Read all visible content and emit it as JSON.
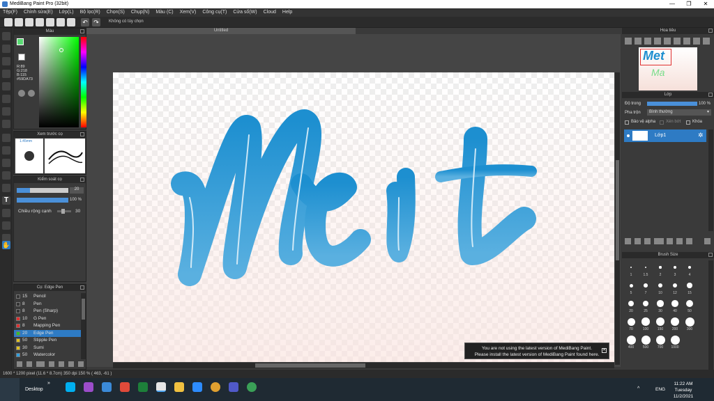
{
  "window": {
    "title": "MediBang Paint Pro (32bit)"
  },
  "menu": [
    "Tệp(F)",
    "Chỉnh sửa(E)",
    "Lớp(L)",
    "Bộ lọc(R)",
    "Chọn(S)",
    "Chụp(N)",
    "Màu (C)",
    "Xem(V)",
    "Công cụ(T)",
    "Cửa sổ(W)",
    "Cloud",
    "Help"
  ],
  "toolbar": {
    "option_text": "Không có tùy chọn"
  },
  "panels": {
    "color": {
      "title": "Màu",
      "r": "R:89",
      "g": "G:218",
      "b": "B:115",
      "hex": "#59DA73"
    },
    "brush_preview": {
      "title": "Xem trước cọ",
      "size": "1.45mm"
    },
    "brush_control": {
      "title": "Kiểm soát cọ",
      "size_val": "20",
      "opacity_val": "100 %",
      "width_label": "Chiều rộng cạnh",
      "width_val": "30",
      "size_level": 0.25,
      "opacity_level": 1.0
    },
    "brush_list": {
      "title": "Cọ: Edge Pen",
      "items": [
        {
          "num": "15",
          "name": "Pencil",
          "color": "#333333"
        },
        {
          "num": "8",
          "name": "Pen",
          "color": "#333333"
        },
        {
          "num": "8",
          "name": "Pen (Sharp)",
          "color": "#333333"
        },
        {
          "num": "10",
          "name": "G Pen",
          "color": "#e03030"
        },
        {
          "num": "8",
          "name": "Mapping Pen",
          "color": "#e03030"
        },
        {
          "num": "20",
          "name": "Edge Pen",
          "color": "#30c030"
        },
        {
          "num": "50",
          "name": "Stipple Pen",
          "color": "#e0c020"
        },
        {
          "num": "30",
          "name": "Sumi",
          "color": "#e0c020"
        },
        {
          "num": "50",
          "name": "Watercolor",
          "color": "#30a0e0"
        }
      ]
    },
    "navigator": {
      "title": "Hoa tiêu"
    },
    "layer": {
      "title": "Lớp",
      "opacity_label": "Độ trong",
      "opacity_val": "100 %",
      "blend_label": "Pha trộn",
      "blend_val": "Bình thường",
      "protect_alpha": "Bảo vệ alpha",
      "clipping": "Xén bớt",
      "lock": "Khóa",
      "layer_name": "Lớp1"
    },
    "brush_size": {
      "title": "Brush Size",
      "sizes": [
        "1",
        "1.5",
        "2",
        "3",
        "4",
        "5",
        "7",
        "10",
        "12",
        "15",
        "20",
        "25",
        "30",
        "40",
        "50",
        "70",
        "100",
        "150",
        "200",
        "300",
        "400",
        "500",
        "700",
        "1000"
      ]
    }
  },
  "canvas": {
    "doc_title": "Untitled",
    "artwork_text": "Met"
  },
  "notice": {
    "line1": "You are not using the latest version of MediBang Paint.",
    "line2": "Please install the latest version of MediBang Paint found here."
  },
  "status": {
    "text": "1600 * 1200 pixel   (11.6 * 8.7cm)   350 dpi   150 %   ( 463, -61 )"
  },
  "taskbar": {
    "desktop": "Desktop",
    "lang": "ENG",
    "time": "11:22 AM",
    "day": "Tuesday",
    "date": "11/2/2021"
  },
  "colors": {
    "accent": "#2e7bc4",
    "stroke_top": "#1d8fd0",
    "stroke_bottom": "#5ab0e0"
  }
}
